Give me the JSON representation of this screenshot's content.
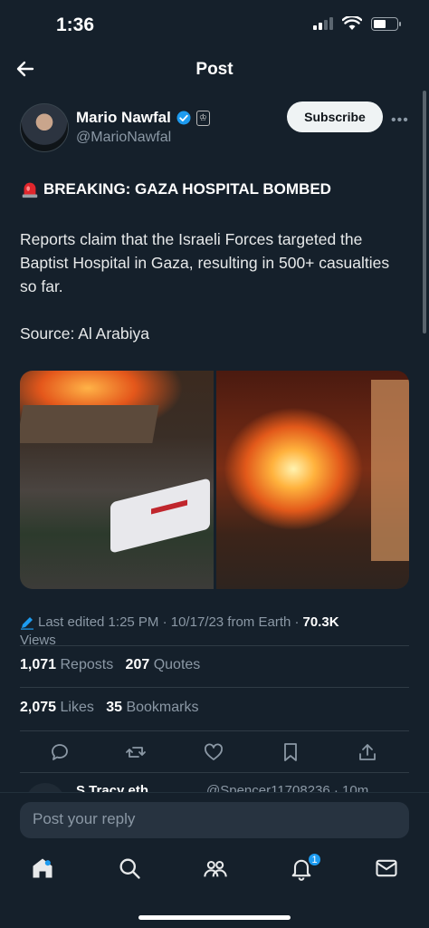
{
  "status_bar": {
    "time": "1:36",
    "battery_level": 0.55
  },
  "nav": {
    "title": "Post"
  },
  "author": {
    "name": "Mario Nawfal",
    "handle": "@MarioNawfal",
    "affiliation_icon": "affiliate-badge-icon"
  },
  "subscribe_label": "Subscribe",
  "post": {
    "headline": "BREAKING: GAZA HOSPITAL BOMBED",
    "body": "Reports claim that the Israeli Forces targeted the Baptist Hospital in Gaza, resulting in 500+ casualties so far.",
    "source": "Source: Al Arabiya"
  },
  "meta": {
    "edited": "Last edited 1:25 PM · 10/17/23  from Earth ·",
    "views_count": "70.3K",
    "views_label": "Views"
  },
  "stats": {
    "reposts_count": "1,071",
    "reposts_label": "Reposts",
    "quotes_count": "207",
    "quotes_label": "Quotes",
    "likes_count": "2,075",
    "likes_label": "Likes",
    "bookmarks_count": "35",
    "bookmarks_label": "Bookmarks"
  },
  "reply_preview": {
    "name": "S Tracy eth",
    "handle": "@Spencer11708236 · 10m"
  },
  "reply_input": {
    "placeholder": "Post your reply"
  },
  "tabbar": {
    "notifications_badge": "1"
  },
  "colors": {
    "background": "#15202b",
    "accent": "#1d9bf0",
    "muted": "#8b98a5"
  }
}
